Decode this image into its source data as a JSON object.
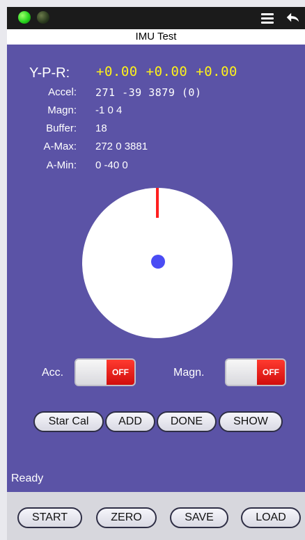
{
  "header": {
    "title": "IMU Test"
  },
  "readings": {
    "ypr_label": "Y-P-R:",
    "ypr_value": "+0.00  +0.00  +0.00",
    "rows": [
      {
        "label": "Accel:",
        "value": "271 -39 3879 (0)"
      },
      {
        "label": "Magn:",
        "value": "-1 0 4"
      },
      {
        "label": "Buffer:",
        "value": "18"
      },
      {
        "label": "A-Max:",
        "value": "272 0 3881"
      },
      {
        "label": "A-Min:",
        "value": "0 -40 0"
      }
    ]
  },
  "toggles": {
    "acc_label": "Acc.",
    "acc_state": "OFF",
    "magn_label": "Magn.",
    "magn_state": "OFF"
  },
  "calibration_buttons": [
    "Star Cal",
    "ADD",
    "DONE",
    "SHOW"
  ],
  "status": {
    "text": "Ready"
  },
  "footer_buttons": [
    "START",
    "ZERO",
    "SAVE",
    "LOAD"
  ],
  "colors": {
    "panel_bg": "#5b53a6",
    "ypr_value": "#fff21a",
    "needle": "#ff1f1f",
    "dot": "#4a4cf4",
    "off_switch": "#d10d0d"
  },
  "icons": {
    "menu": "menu-icon",
    "back": "back-arrow-icon",
    "led_on": "green-led-icon",
    "led_off": "dim-led-icon"
  }
}
